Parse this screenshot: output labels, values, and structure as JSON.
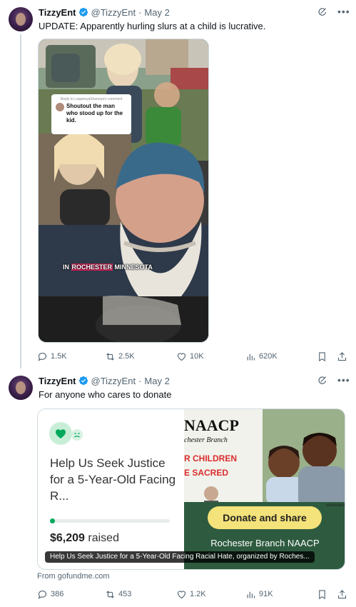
{
  "tweets": [
    {
      "name": "TizzyEnt",
      "handle": "@TizzyEnt",
      "date": "May 2",
      "text": "UPDATE: Apparently hurling slurs at a child is lucrative.",
      "media": {
        "reply_sub": "Reply to LaqueeyaShaneya's comment",
        "reply_text": "Shoutout the man who stood up for the kid.",
        "caption_pre": "IN ",
        "caption_hl": "ROCHESTER",
        "caption_post": " MINNESOTA"
      },
      "stats": {
        "replies": "1.5K",
        "reposts": "2.5K",
        "likes": "10K",
        "views": "620K"
      }
    },
    {
      "name": "TizzyEnt",
      "handle": "@TizzyEnt",
      "date": "May 2",
      "text": "For anyone who cares to donate",
      "card": {
        "title": "Help Us Seek Justice for a 5-Year-Old Facing R...",
        "raised_amount": "$6,209",
        "raised_label": "raised",
        "progress": 0.03,
        "naacp": "NAACP",
        "branch_italic": "chester Branch",
        "red_line_1": "R CHILDREN",
        "red_line_2": "E SACRED",
        "donate_label": "Donate and share",
        "branch_name": "Rochester Branch NAACP",
        "rochester_tag": "ochesterm",
        "overlay": "Help Us Seek Justice for a 5-Year-Old Facing Racial Hate, organized by Roches...",
        "from_label": "From gofundme.com"
      },
      "stats": {
        "replies": "386",
        "reposts": "453",
        "likes": "1.2K",
        "views": "91K"
      }
    }
  ],
  "colors": {
    "verified": "#1d9bf0",
    "text_secondary": "#536471",
    "gofundme_green": "#02a95c",
    "naacp_red": "#d92d2d"
  },
  "icons": [
    "grok-icon",
    "more-icon",
    "reply-icon",
    "repost-icon",
    "like-icon",
    "views-icon",
    "bookmark-icon",
    "share-icon",
    "verified-badge-icon"
  ]
}
